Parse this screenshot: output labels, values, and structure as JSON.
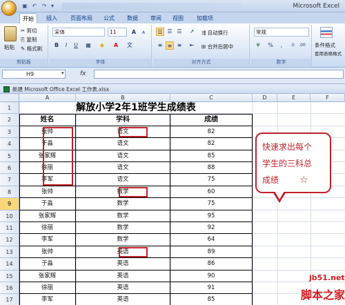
{
  "app": {
    "title": "Microsoft Excel",
    "quick_access": [
      "save-icon",
      "undo-icon",
      "redo-icon"
    ],
    "tabs": [
      "开始",
      "插入",
      "页面布局",
      "公式",
      "数据",
      "审阅",
      "视图",
      "加载项"
    ],
    "active_tab": "开始"
  },
  "ribbon": {
    "clipboard": {
      "paste": "粘贴",
      "cut": "剪切",
      "copy": "复制",
      "format_painter": "格式刷",
      "label": "剪贴板"
    },
    "font": {
      "name": "宋体",
      "size": "11",
      "bold": "B",
      "italic": "I",
      "underline": "U",
      "grow": "A",
      "shrink": "A",
      "font_color": "A",
      "fill": "◆",
      "label": "字体"
    },
    "alignment": {
      "wrap": "自动换行",
      "merge": "合并后居中",
      "label": "对齐方式"
    },
    "number": {
      "format": "常规",
      "percent": "%",
      "comma": ",",
      "currency": "¥",
      "label": "数字"
    },
    "styles": {
      "conditional": "条件格式",
      "format_table": "套用表格格式"
    }
  },
  "formula_bar": {
    "name_box": "H9",
    "fx": "fx",
    "value": ""
  },
  "workbook": {
    "title": "新建 Microsoft Office Excel 工作表.xlsx"
  },
  "sheet": {
    "columns": [
      "A",
      "B",
      "C",
      "D",
      "E",
      "F"
    ],
    "rows": [
      "1",
      "2",
      "3",
      "4",
      "5",
      "6",
      "7",
      "8",
      "9",
      "10",
      "11",
      "12",
      "13",
      "14",
      "15",
      "16",
      "17"
    ],
    "selected_row": "9",
    "title": "解放小学2年1班学生成绩表",
    "headers": [
      "姓名",
      "学科",
      "成绩"
    ],
    "data": [
      [
        "张帅",
        "语文",
        "82"
      ],
      [
        "于淼",
        "语文",
        "82"
      ],
      [
        "张家辉",
        "语文",
        "85"
      ],
      [
        "徐丽",
        "语文",
        "88"
      ],
      [
        "李军",
        "语文",
        "75"
      ],
      [
        "张帅",
        "数学",
        "60"
      ],
      [
        "于淼",
        "数学",
        "75"
      ],
      [
        "张家辉",
        "数学",
        "95"
      ],
      [
        "徐丽",
        "数学",
        "92"
      ],
      [
        "李军",
        "数学",
        "64"
      ],
      [
        "张帅",
        "英语",
        "89"
      ],
      [
        "于淼",
        "英语",
        "86"
      ],
      [
        "张家辉",
        "英语",
        "90"
      ],
      [
        "徐丽",
        "英语",
        "91"
      ],
      [
        "李军",
        "英语",
        "85"
      ]
    ]
  },
  "callout": {
    "lines": [
      "快速求出每个",
      "学生的三科总",
      "成绩"
    ],
    "star": "☆"
  },
  "watermark": {
    "site": "jb51.net",
    "name": "脚本之家"
  },
  "colors": {
    "accent_red": "#c0202a",
    "ribbon_blue": "#dfe9f7",
    "selected_row": "#f9d77c"
  }
}
